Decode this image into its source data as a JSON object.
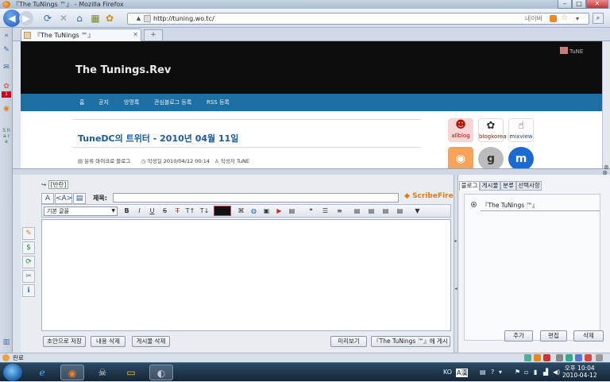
{
  "window": {
    "title": "『The TuNings ™』 - Mozilla Firefox",
    "controls": [
      "–",
      "□",
      "✕"
    ]
  },
  "nav": {
    "url": "http://tuning.wo.tc/",
    "site_dropdown": "▲",
    "naver_label": "네이버"
  },
  "tabs": [
    {
      "label": "『The TuNings ™』"
    }
  ],
  "newtab": "+",
  "site": {
    "title": "The Tunings.Rev",
    "logo_text": "TuNE",
    "menu": [
      "홈",
      "공지",
      "방명록",
      "관심블로그 등록",
      "RSS 등록"
    ],
    "post_title": "TuneDC의 트위터 - 2010년 04월 11일",
    "meta": {
      "category_label": "분류",
      "category_value": "마이크로 블로그",
      "date_label": "작성일",
      "date_value": "2010/04/12 00:14",
      "author_label": "작성자",
      "author_value": "TuNE"
    },
    "sidebar_badges": [
      "allblog",
      "blogkorea",
      "mixview",
      "",
      "g",
      "m"
    ]
  },
  "scribefire": {
    "restore_label": "[반란]",
    "title_label": "제목:",
    "title_value": "",
    "brand": "ScribeFire",
    "font_select": "기본 글꼴",
    "buttons": {
      "save_draft": "초안으로 저장",
      "delete_content": "내용 삭제",
      "delete_post": "게시물 삭제",
      "preview": "미리보기",
      "publish": "『The TuNings ™』에 게시"
    },
    "right_tabs": [
      "블로그",
      "게시물",
      "분류",
      "선택사항"
    ],
    "blog_item": "『The TuNings ™』",
    "right_buttons": {
      "add": "추가",
      "edit": "편집",
      "delete": "삭제"
    }
  },
  "status": {
    "text": "완료"
  },
  "tray": {
    "lang": "KO",
    "ime": "A漢",
    "time": "오후 10:04",
    "date": "2010-04-12"
  }
}
